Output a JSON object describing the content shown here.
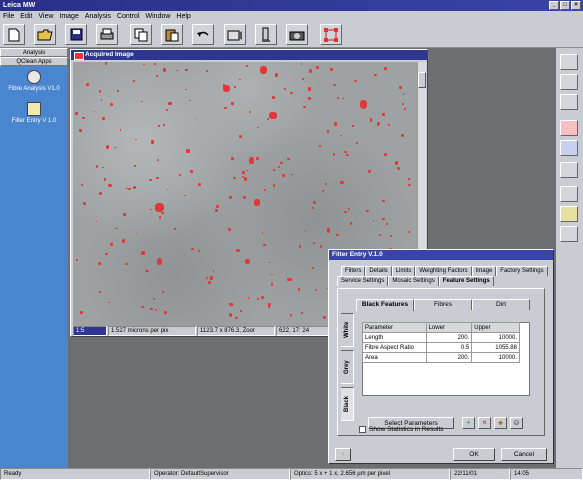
{
  "app": {
    "title": "Leica MW"
  },
  "menu": [
    "File",
    "Edit",
    "View",
    "Image",
    "Analysis",
    "Control",
    "Window",
    "Help"
  ],
  "sidebar": {
    "tabs": [
      "Analysis",
      "QClean Apps"
    ],
    "apps": [
      {
        "label": "Fibre Analysis V1.0",
        "icon": "magnifier-icon"
      },
      {
        "label": "Filter Entry V 1.0",
        "icon": "document-icon"
      }
    ]
  },
  "image_window": {
    "title": "Acquired Image",
    "zoom": "1:5",
    "status": [
      "1.527 microns per pix",
      "1123.7 x 876.3, Zoor",
      "622, 17: 24"
    ]
  },
  "dialog": {
    "title": "Filter Entry V.1.0",
    "tabs_row1": [
      "Filters",
      "Details",
      "Limits",
      "Weighting Factors",
      "Image",
      "Factory Settings"
    ],
    "tabs_row2": [
      "Service Settings",
      "Mosaic Settings",
      "Feature Settings"
    ],
    "content_tabs": [
      "Black Features",
      "Fibres",
      "Dirt"
    ],
    "side_tabs": [
      "White",
      "Grey",
      "Black"
    ],
    "table": {
      "headers": [
        "Parameter",
        "Lower",
        "Upper"
      ],
      "rows": [
        [
          "Length",
          "200.",
          "10000."
        ],
        [
          "Fibre Aspect Ratio",
          "0.5",
          "1055.88"
        ],
        [
          "Area",
          "200.",
          "10000."
        ]
      ]
    },
    "select_label": "Select Parameters",
    "checkbox_label": "Show Statistics in Results",
    "ok_label": "OK",
    "cancel_label": "Cancel"
  },
  "status": {
    "ready": "Ready",
    "operator": "Operator: DefaultSupervisor",
    "optics": "Optics: 5 x + 1 x, 2.656 µm per pixel",
    "date": "22/11/01",
    "time": "14:05"
  },
  "colors": {
    "title": "#2e3692",
    "sidebar": "#4a86cf",
    "particles": "#e0383a"
  }
}
